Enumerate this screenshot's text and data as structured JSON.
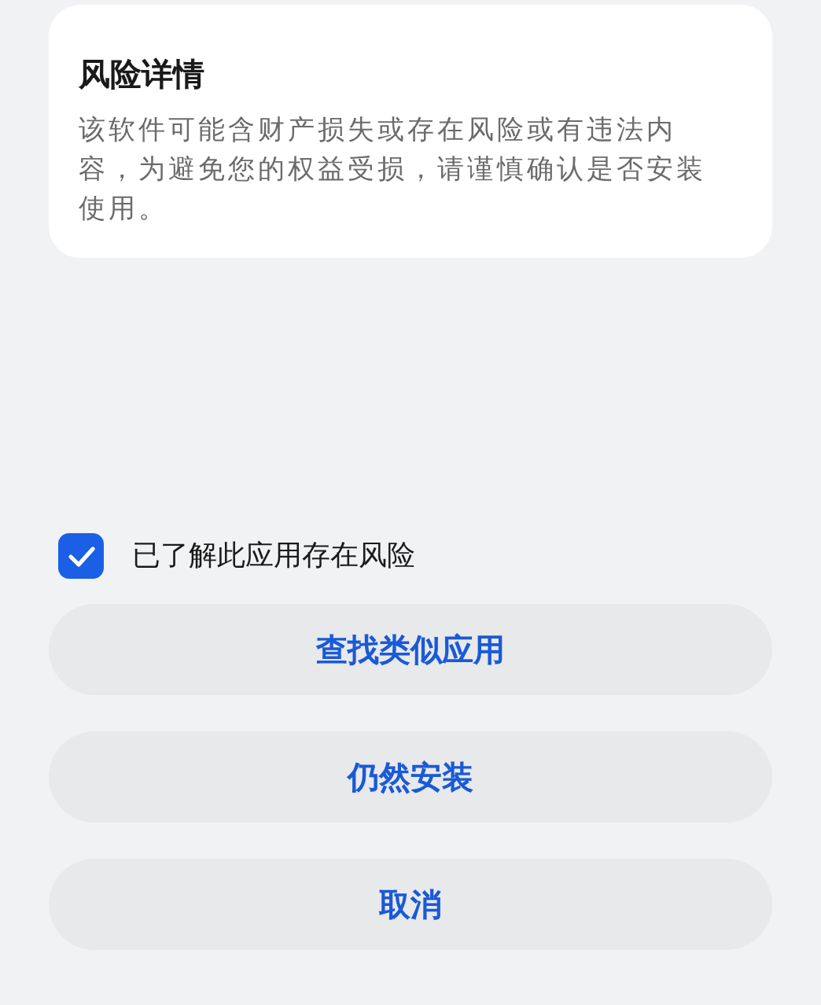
{
  "risk_card": {
    "title": "风险详情",
    "description": "该软件可能含财产损失或存在风险或有违法内容，为避免您的权益受损，请谨慎确认是否安装使用。"
  },
  "acknowledge": {
    "label": "已了解此应用存在风险",
    "checked": true
  },
  "buttons": [
    {
      "label": "查找类似应用"
    },
    {
      "label": "仍然安装"
    },
    {
      "label": "取消"
    }
  ]
}
